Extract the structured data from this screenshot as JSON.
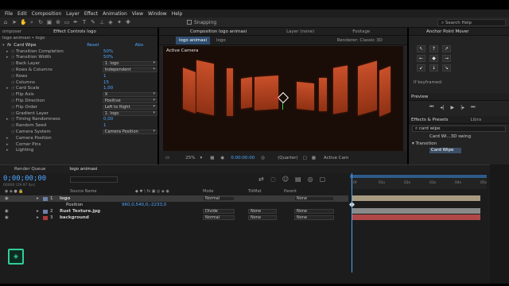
{
  "menu": [
    "File",
    "Edit",
    "Composition",
    "Layer",
    "Effect",
    "Animation",
    "View",
    "Window",
    "Help"
  ],
  "toolbar": {
    "snapping": "Snapping",
    "search_help": "Search Help"
  },
  "panels": {
    "project_tab": "omposer",
    "effect_controls_tab": "Effect Controls logo",
    "fx_breadcrumb": "logo animasi • logo",
    "composition_tab": "Composition logo animasi",
    "layer_tab": "Layer (none)",
    "footage_tab": "Footage",
    "comp_subtabs": [
      "logo animasi",
      "logo"
    ],
    "renderer": "Renderer:  Classic 3D",
    "active_camera": "Active Camera",
    "anchor_point_mover": "Anchor Point Mover",
    "if_keyframed": "If keyframed:",
    "preview": "Preview",
    "effects_presets": "Effects & Presets",
    "libraries": "Libra",
    "search_effects": "card wipe",
    "preset_item": "Card Wi...3D swing",
    "category": "Transition",
    "effect_result": "Card Wipe"
  },
  "effect": {
    "name": "Card Wipe",
    "reset": "Reset",
    "about": "Abo",
    "properties": [
      {
        "label": "Transition Completion",
        "value": "50%",
        "type": "num"
      },
      {
        "label": "Transition Width",
        "value": "50%",
        "type": "num"
      },
      {
        "label": "Back Layer",
        "value": "1. logo",
        "type": "dd"
      },
      {
        "label": "Rows & Columns",
        "value": "Independent",
        "type": "dd"
      },
      {
        "label": "Rows",
        "value": "1",
        "type": "num"
      },
      {
        "label": "Columns",
        "value": "15",
        "type": "num"
      },
      {
        "label": "Card Scale",
        "value": "1,00",
        "type": "num"
      },
      {
        "label": "Flip Axis",
        "value": "X",
        "type": "dd"
      },
      {
        "label": "Flip Direction",
        "value": "Positive",
        "type": "dd"
      },
      {
        "label": "Flip Order",
        "value": "Left to Right",
        "type": "dd"
      },
      {
        "label": "Gradient Layer",
        "value": "1. logo",
        "type": "dd"
      },
      {
        "label": "Timing Randomness",
        "value": "0,00",
        "type": "num"
      },
      {
        "label": "Random Seed",
        "value": "1",
        "type": "num"
      },
      {
        "label": "Camera System",
        "value": "Camera Position",
        "type": "dd"
      },
      {
        "label": "Camera Position",
        "value": "",
        "type": "group"
      },
      {
        "label": "Corner Pins",
        "value": "",
        "type": "group"
      },
      {
        "label": "Lighting",
        "value": "",
        "type": "group"
      }
    ]
  },
  "viewer": {
    "zoom": "25%",
    "time": "0:00:00:00",
    "resolution": "(Quarter)",
    "camera": "Active Cam"
  },
  "timeline": {
    "render_queue": "Render Queue",
    "comp_tab": "logo animasi",
    "timecode": "0;00;00;00",
    "fps": "00000 (29.97 fps)",
    "columns": {
      "source": "Source Name",
      "mode": "Mode",
      "trkmat": "TrkMat",
      "parent": "Parent"
    },
    "layers": [
      {
        "num": "1",
        "name": "logo",
        "mode": "Normal",
        "trkmat": "",
        "parent": "None",
        "color": "#6f7fa8"
      },
      {
        "num": "",
        "name": "Position",
        "mode": "",
        "trkmat": "",
        "parent": "",
        "color": ""
      },
      {
        "num": "2",
        "name": "Rust Texture.jpg",
        "mode": "Divide",
        "trkmat": "None",
        "parent": "None",
        "color": "#6f7fa8"
      },
      {
        "num": "3",
        "name": "background",
        "mode": "Normal",
        "trkmat": "None",
        "parent": "None",
        "color": "#b03a3a"
      }
    ],
    "position_value": "960,0,540,0,-2233,0",
    "ruler_ticks": [
      "0f",
      "01s",
      "02s",
      "03s",
      "04s",
      "05s"
    ]
  },
  "colors": {
    "accent": "#4ea6ff",
    "bar_tan": "#a89a80",
    "bar_gray": "#8a8a8a",
    "bar_red": "#b04848"
  }
}
